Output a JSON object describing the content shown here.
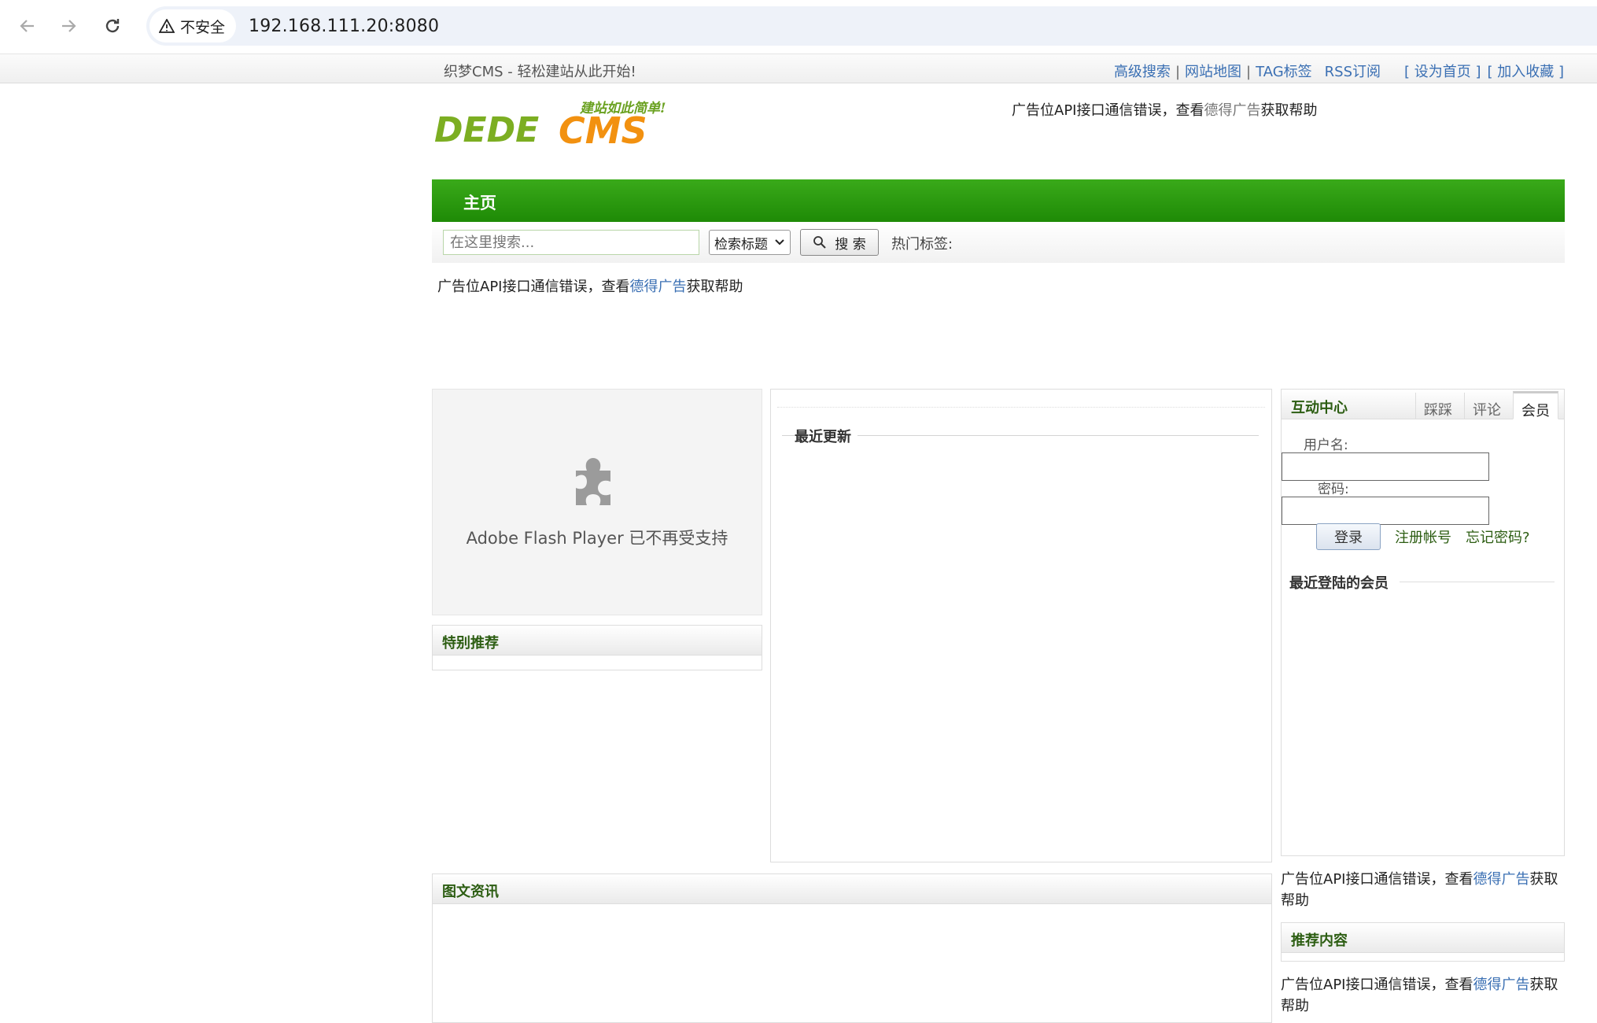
{
  "browser": {
    "security_label": "不安全",
    "url": "192.168.111.20:8080"
  },
  "topbar": {
    "welcome": "织梦CMS - 轻松建站从此开始!",
    "links": [
      "高级搜索",
      "网站地图",
      "TAG标签",
      "RSS订阅"
    ],
    "set_home": "[ 设为首页 ]",
    "favorite": "[ 加入收藏 ]"
  },
  "logo": {
    "slogan": "建站如此简单!",
    "text_dede": "DEDE",
    "text_cms": "CMS"
  },
  "ad": {
    "prefix": "广告位API接口通信错误，查看",
    "link": "德得广告",
    "suffix": "获取帮助"
  },
  "nav": {
    "home": "主页"
  },
  "search": {
    "placeholder": "在这里搜索...",
    "select_value": "检索标题",
    "button": "搜 索",
    "hot_tags": "热门标签:"
  },
  "flash": {
    "message": "Adobe Flash Player 已不再受支持"
  },
  "boxes": {
    "special": "特别推荐",
    "latest": "最近更新",
    "pictures": "图文资讯",
    "recommend": "推荐内容"
  },
  "interaction": {
    "title": "互动中心",
    "tabs": [
      "踩踩",
      "评论",
      "会员"
    ],
    "active_tab": "会员",
    "username_label": "用户名:",
    "password_label": "密码:",
    "login_button": "登录",
    "register_link": "注册帐号",
    "forgot_link": "忘记密码?",
    "recent_members": "最近登陆的会员"
  },
  "colors": {
    "nav_green": "#1e8a06",
    "link_blue": "#3a6fb3",
    "heading_green": "#2c5d12"
  }
}
